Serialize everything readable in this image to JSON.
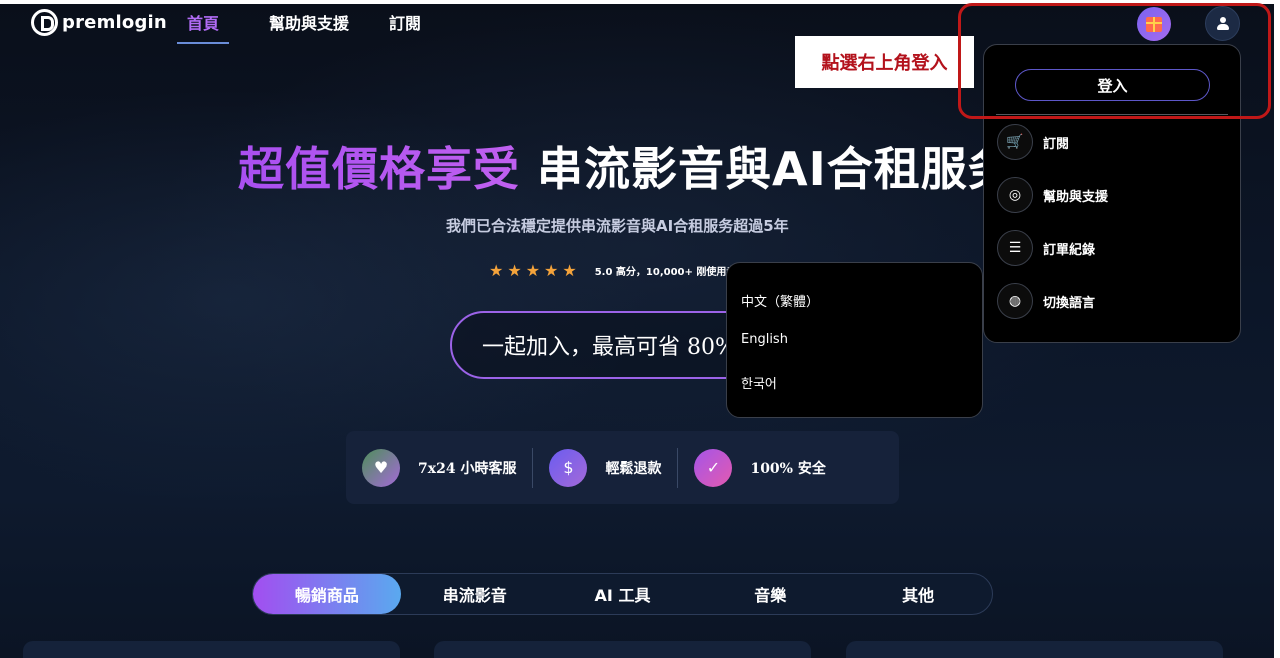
{
  "header": {
    "logo_text": "premlogin",
    "nav": [
      {
        "label": "首頁",
        "active": true
      },
      {
        "label": "幫助與支援",
        "active": false
      },
      {
        "label": "訂閱",
        "active": false
      }
    ]
  },
  "hero": {
    "title_highlight": "超值價格享受",
    "title_rest": " 串流影音與AI合租服务",
    "subtitle": "我們已合法穩定提供串流影音與AI合租服务超過5年",
    "rating_text": "5.0 高分，10,000+ 刚使用者",
    "stars": 5,
    "cta_label": "一起加入，最高可省 80%"
  },
  "features": [
    {
      "icon": "heart-hands-icon",
      "label": "7x24 小時客服"
    },
    {
      "icon": "refund-icon",
      "label": "輕鬆退款"
    },
    {
      "icon": "shield-check-icon",
      "label": "100% 安全"
    }
  ],
  "tabs": [
    {
      "label": "暢銷商品",
      "active": true
    },
    {
      "label": "串流影音",
      "active": false
    },
    {
      "label": "AI 工具",
      "active": false
    },
    {
      "label": "音樂",
      "active": false
    },
    {
      "label": "其他",
      "active": false
    }
  ],
  "annotation": {
    "text": "點選右上角登入",
    "color": "#c01818"
  },
  "user_menu": {
    "login_label": "登入",
    "items": [
      {
        "icon": "cart-icon",
        "label": "訂閱"
      },
      {
        "icon": "lifebuoy-icon",
        "label": "幫助與支援"
      },
      {
        "icon": "document-icon",
        "label": "訂單紀錄"
      },
      {
        "icon": "globe-icon",
        "label": "切換語言"
      }
    ]
  },
  "language_menu": {
    "options": [
      "中文（繁體）",
      "English",
      "한국어"
    ]
  },
  "colors": {
    "accent_purple": "#b26cf6",
    "star": "#f4a33b",
    "background": "#0b1220"
  }
}
